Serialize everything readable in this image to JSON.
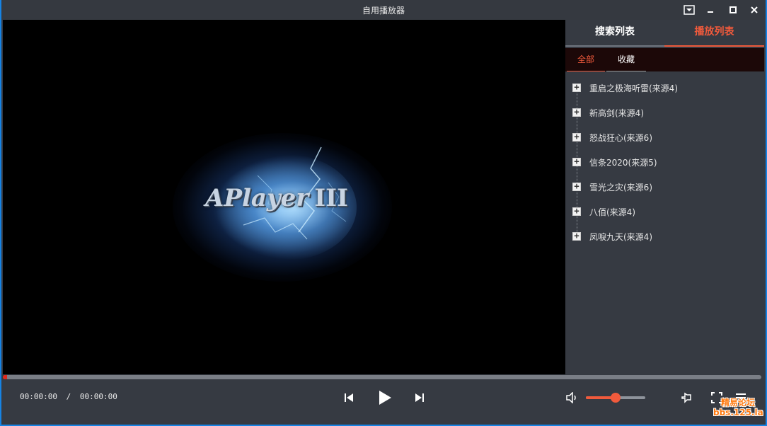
{
  "window": {
    "title": "自用播放器",
    "buttons": [
      "dropdown",
      "minimize",
      "maximize",
      "close"
    ]
  },
  "video": {
    "logo_text": "APlayer",
    "logo_suffix": "III"
  },
  "panel": {
    "tabs": [
      {
        "label": "搜索列表",
        "active": false
      },
      {
        "label": "播放列表",
        "active": true
      }
    ],
    "subtabs": [
      {
        "label": "全部",
        "active": true
      },
      {
        "label": "收藏",
        "active": false
      }
    ],
    "items": [
      {
        "label": "重启之极海听雷(来源4)"
      },
      {
        "label": "新高剑(来源4)"
      },
      {
        "label": "怒战狂心(来源6)"
      },
      {
        "label": "信条2020(来源5)"
      },
      {
        "label": "雪光之灾(来源6)"
      },
      {
        "label": "八佰(来源4)"
      },
      {
        "label": "凤唳九天(来源4)"
      }
    ]
  },
  "player": {
    "current_time": "00:00:00",
    "separator": "/",
    "total_time": "00:00:00",
    "progress": 0.005,
    "volume": 0.5,
    "icons": [
      "prev-icon",
      "play-icon",
      "next-icon",
      "volume-icon",
      "pin-icon",
      "fullscreen-icon",
      "playlist-icon"
    ]
  },
  "colors": {
    "accent": "#f15a3c",
    "background": "#363a42",
    "border": "#1683e4"
  },
  "watermark": {
    "line1": "精易论坛",
    "line2": "bbs.125.la"
  }
}
